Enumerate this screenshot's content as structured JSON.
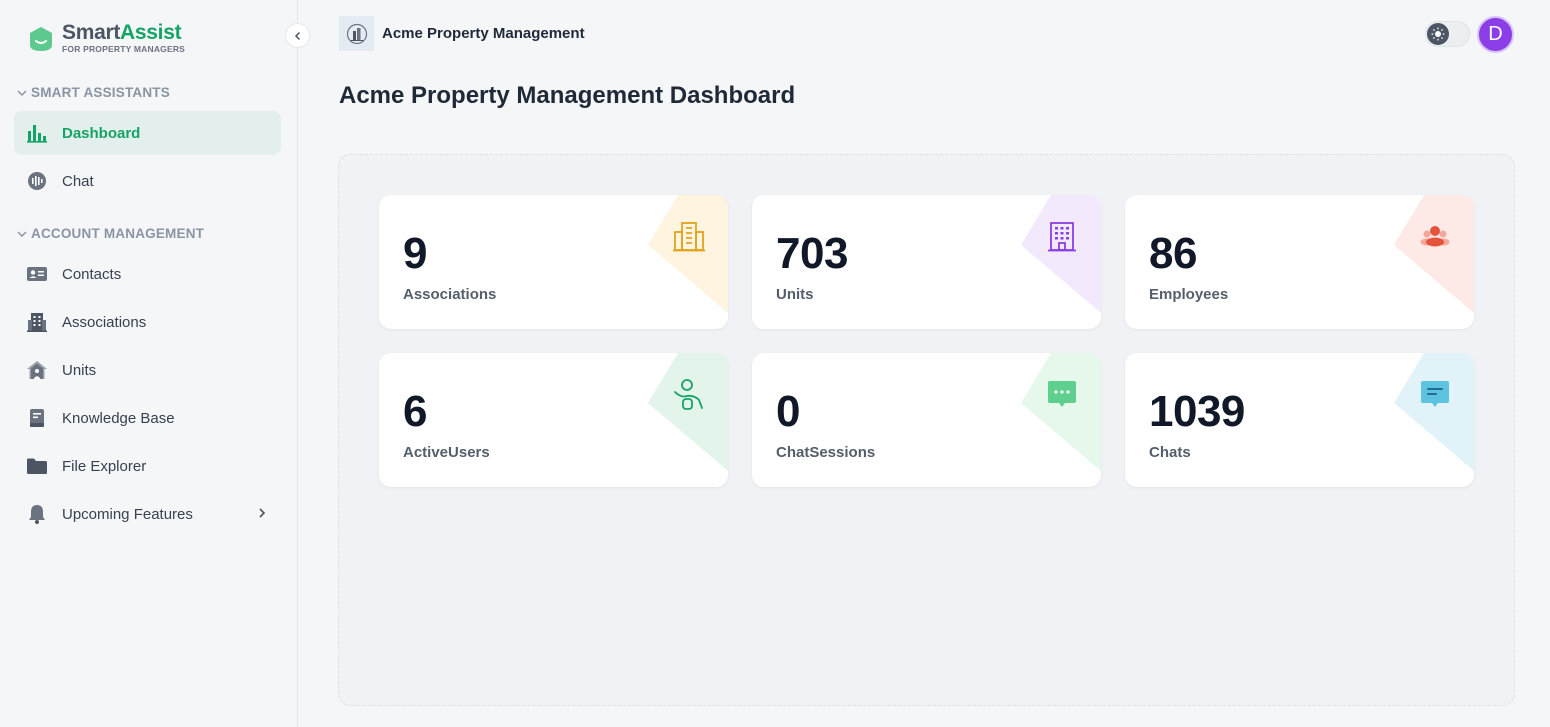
{
  "app": {
    "logo_smart": "Smart",
    "logo_assist": "Assist",
    "logo_subtitle": "FOR PROPERTY MANAGERS"
  },
  "sidebar": {
    "sections": [
      {
        "title": "SMART ASSISTANTS",
        "items": [
          {
            "label": "Dashboard",
            "icon": "bar-chart-icon",
            "active": true
          },
          {
            "label": "Chat",
            "icon": "chat-icon"
          }
        ]
      },
      {
        "title": "ACCOUNT MANAGEMENT",
        "items": [
          {
            "label": "Contacts",
            "icon": "contact-card-icon"
          },
          {
            "label": "Associations",
            "icon": "building-icon"
          },
          {
            "label": "Units",
            "icon": "house-icon"
          },
          {
            "label": "Knowledge Base",
            "icon": "book-icon"
          },
          {
            "label": "File Explorer",
            "icon": "folder-icon"
          },
          {
            "label": "Upcoming Features",
            "icon": "bell-icon",
            "has_submenu": true
          }
        ]
      }
    ]
  },
  "header": {
    "org_name": "Acme Property Management",
    "avatar_initial": "D"
  },
  "page": {
    "title": "Acme Property Management Dashboard"
  },
  "stats": [
    {
      "value": "9",
      "label": "Associations",
      "icon": "office-building-icon",
      "accent": "#e3a21a",
      "tint": "#fef4df"
    },
    {
      "value": "703",
      "label": "Units",
      "icon": "apartment-icon",
      "accent": "#8b3de6",
      "tint": "#f3e9fd"
    },
    {
      "value": "86",
      "label": "Employees",
      "icon": "people-icon",
      "accent": "#e5533d",
      "tint": "#fde9e5"
    },
    {
      "value": "6",
      "label": "ActiveUsers",
      "icon": "user-wave-icon",
      "accent": "#16a366",
      "tint": "#e3f4ea"
    },
    {
      "value": "0",
      "label": "ChatSessions",
      "icon": "chat-bubble-icon",
      "accent": "#3fbf72",
      "tint": "#e6f7ec"
    },
    {
      "value": "1039",
      "label": "Chats",
      "icon": "message-icon",
      "accent": "#3fb4d6",
      "tint": "#e1f3f9"
    }
  ],
  "colors": {
    "brand": "#16a366",
    "active_bg": "#e2efec",
    "avatar": "#8b3de6"
  }
}
